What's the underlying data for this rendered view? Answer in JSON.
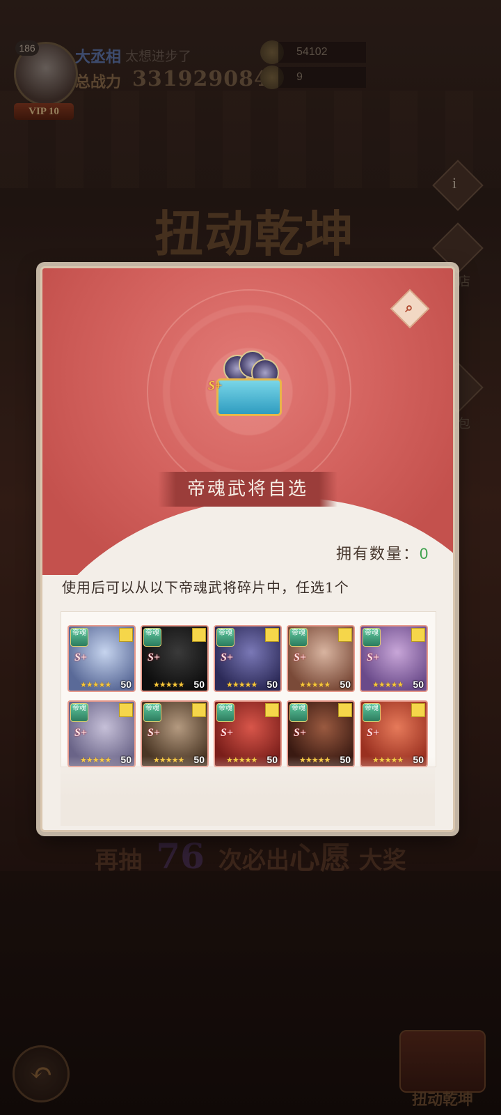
{
  "player": {
    "level": "186",
    "name": "大丞相",
    "motto": "太想进步了",
    "power_label": "总战力",
    "power": "331929084",
    "vip": "VIP 10"
  },
  "resources": [
    {
      "icon": "gold-ingot-icon",
      "value": "54102"
    },
    {
      "icon": "token-icon",
      "value": "9"
    }
  ],
  "page_title": "扭动乾坤",
  "side": {
    "info_icon": "i",
    "shop_label": "商店",
    "gift_label": "礼包"
  },
  "bottom": {
    "prefix": "再抽",
    "count": "76",
    "middle": "次必出",
    "highlight": "心愿",
    "suffix": "大奖"
  },
  "nav": {
    "back_glyph": "↶",
    "right_label": "扭动乾坤"
  },
  "modal": {
    "title": "帝魂武将自选",
    "chest_tag": "S+",
    "owned_label": "拥有数量：",
    "owned_value": "0",
    "description": "使用后可以从以下帝魂武将碎片中，任选1个",
    "magnify_glyph": "⌕",
    "cards": [
      {
        "badge": "帝魂",
        "tag": "S+",
        "stars": "★★★★★",
        "level": "50",
        "colors": [
          "#c6d4ee",
          "#5a6a98"
        ]
      },
      {
        "badge": "帝魂",
        "tag": "S+",
        "stars": "★★★★★",
        "level": "50",
        "colors": [
          "#3a3a3a",
          "#0e0e0e"
        ]
      },
      {
        "badge": "帝魂",
        "tag": "S+",
        "stars": "★★★★★",
        "level": "50",
        "colors": [
          "#7a78b6",
          "#2c2a58"
        ]
      },
      {
        "badge": "帝魂",
        "tag": "S+",
        "stars": "★★★★★",
        "level": "50",
        "colors": [
          "#d8b4a0",
          "#7a4a38"
        ]
      },
      {
        "badge": "帝魂",
        "tag": "S+",
        "stars": "★★★★★",
        "level": "50",
        "colors": [
          "#c8a6d8",
          "#6a4a8a"
        ]
      },
      {
        "badge": "帝魂",
        "tag": "S+",
        "stars": "★★★★★",
        "level": "50",
        "colors": [
          "#c6c0d8",
          "#6a6488"
        ]
      },
      {
        "badge": "帝魂",
        "tag": "S+",
        "stars": "★★★★★",
        "level": "50",
        "colors": [
          "#b49a80",
          "#4a3624"
        ]
      },
      {
        "badge": "帝魂",
        "tag": "S+",
        "stars": "★★★★★",
        "level": "50",
        "colors": [
          "#d8564a",
          "#7a1e1a"
        ]
      },
      {
        "badge": "帝魂",
        "tag": "S+",
        "stars": "★★★★★",
        "level": "50",
        "colors": [
          "#9a5a40",
          "#3a1a12"
        ]
      },
      {
        "badge": "帝魂",
        "tag": "S+",
        "stars": "★★★★★",
        "level": "50",
        "colors": [
          "#e67a5a",
          "#9a3020"
        ]
      }
    ]
  }
}
